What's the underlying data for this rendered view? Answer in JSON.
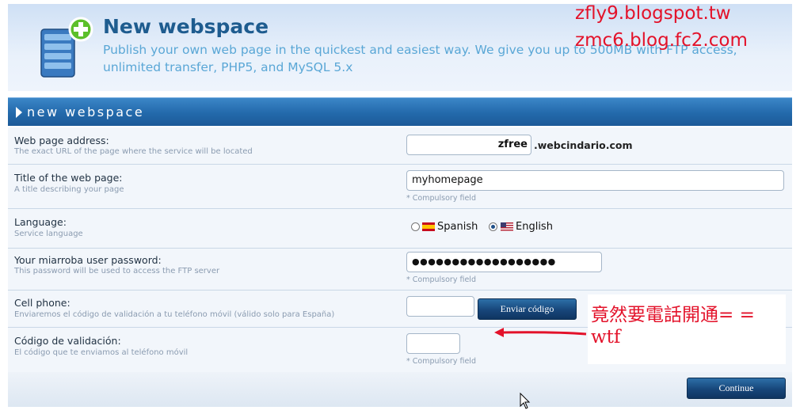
{
  "header": {
    "title": "New webspace",
    "description": "Publish your own web page in the quickest and easiest way. We give you up to 500MB with FTP access, unlimited transfer, PHP5, and MySQL 5.x"
  },
  "watermarks": [
    "zfly9.blogspot.tw",
    "zmc6.blog.fc2.com"
  ],
  "section": {
    "title": "new webspace"
  },
  "form": {
    "address": {
      "label": "Web page address:",
      "sublabel": "The exact URL of the page where the service will be located",
      "value": "zfree",
      "suffix": ".webcindario.com"
    },
    "page_title": {
      "label": "Title of the web page:",
      "sublabel": "A title describing your page",
      "value": "myhomepage",
      "hint": "* Compulsory field"
    },
    "language": {
      "label": "Language:",
      "sublabel": "Service language",
      "options": [
        {
          "label": "Spanish",
          "checked": false,
          "flag": "spain-flag-icon"
        },
        {
          "label": "English",
          "checked": true,
          "flag": "us-flag-icon"
        }
      ]
    },
    "password": {
      "label": "Your miarroba user password:",
      "sublabel": "This password will be used to access the FTP server",
      "value": "●●●●●●●●●●●●●●●●●●",
      "hint": "* Compulsory field"
    },
    "cell_phone": {
      "label": "Cell phone:",
      "sublabel": "Enviaremos el código de validación a tu teléfono móvil (válido solo para España)",
      "value": "",
      "button": "Enviar código"
    },
    "validation": {
      "label": "Código de validación:",
      "sublabel": "El código que te enviamos al teléfono móvil",
      "value": "",
      "hint": "* Compulsory field"
    }
  },
  "footer": {
    "continue_label": "Continue"
  },
  "annotation": {
    "line1": "竟然要電話開通= =",
    "line2": "wtf"
  },
  "colors": {
    "accent": "#1f5c93",
    "link": "#5aa7d6",
    "annotation": "#e3122a"
  }
}
